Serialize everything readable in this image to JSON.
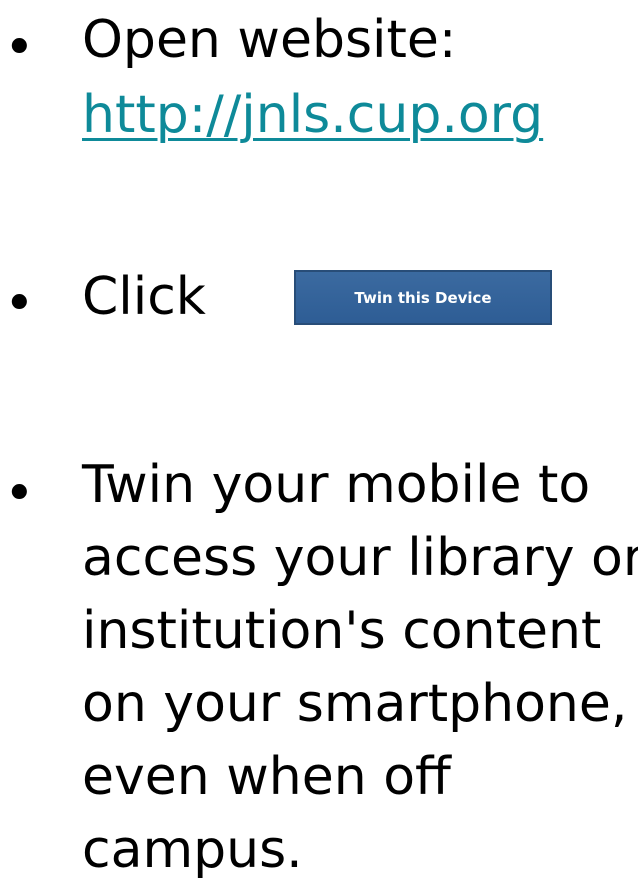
{
  "bullets": {
    "symbol": "•"
  },
  "step1": {
    "label": "Open website:",
    "link_text": "http://jnls.cup.org"
  },
  "step2": {
    "label": "Click",
    "button_label": "Twin this Device"
  },
  "step3": {
    "lines": [
      "Twin your mobile to",
      "access your library or",
      "institution's content",
      "on your smartphone,",
      "even when off",
      "campus."
    ]
  },
  "colors": {
    "link": "#0e8a99",
    "button_bg": "#2e5d95",
    "button_text": "#ffffff"
  }
}
